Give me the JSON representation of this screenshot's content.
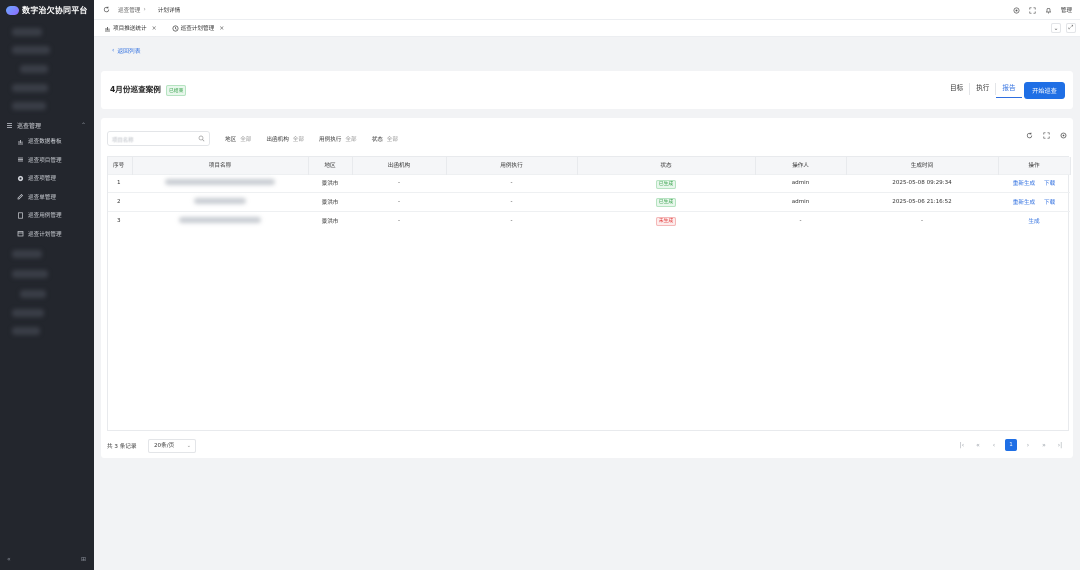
{
  "app": {
    "title": "数字治欠协同平台"
  },
  "sidebar": {
    "group_label": "巡查管理",
    "items": [
      {
        "label": "巡查数据看板",
        "icon": "chart-icon"
      },
      {
        "label": "巡查项目管理",
        "icon": "list-icon"
      },
      {
        "label": "巡查项管理",
        "icon": "gear-icon"
      },
      {
        "label": "巡查单管理",
        "icon": "edit-icon"
      },
      {
        "label": "巡查用例管理",
        "icon": "document-icon"
      },
      {
        "label": "巡查计划管理",
        "icon": "calendar-icon"
      }
    ],
    "collapse_label": "«",
    "settings_label": "⊞"
  },
  "topbar": {
    "breadcrumb_1": "巡查管理",
    "breadcrumb_sep": "›",
    "breadcrumb_2": "计划详情",
    "user": "管理"
  },
  "tabs": [
    {
      "label": "项目推送统计",
      "close": "×"
    },
    {
      "label": "巡查计划管理",
      "close": "×"
    }
  ],
  "back_link": "返回列表",
  "header": {
    "title": "4月份巡查案例",
    "badge": "已结束",
    "tabs": [
      "目标",
      "执行",
      "报告"
    ],
    "active_tab": "报告",
    "start_button": "开始巡查"
  },
  "filters": {
    "search_placeholder": "项目名称",
    "items": [
      {
        "label": "地区",
        "value": "全部"
      },
      {
        "label": "出函机构",
        "value": "全部"
      },
      {
        "label": "用例执行",
        "value": "全部"
      },
      {
        "label": "状态",
        "value": "全部"
      }
    ]
  },
  "table": {
    "headers": [
      "序号",
      "项目名称",
      "地区",
      "出函机构",
      "用例执行",
      "状态",
      "操作人",
      "生成时间",
      "操作"
    ],
    "rows": [
      {
        "no": "1",
        "region": "景洪市",
        "org": "-",
        "exec": "-",
        "status": "已生成",
        "status_type": "ok",
        "operator": "admin",
        "time": "2025-05-08 09:29:34",
        "op1": "重新生成",
        "op2": "下载"
      },
      {
        "no": "2",
        "region": "景洪市",
        "org": "-",
        "exec": "-",
        "status": "已生成",
        "status_type": "ok",
        "operator": "admin",
        "time": "2025-05-06 21:16:52",
        "op1": "重新生成",
        "op2": "下载"
      },
      {
        "no": "3",
        "region": "景洪市",
        "org": "-",
        "exec": "-",
        "status": "未生成",
        "status_type": "no",
        "operator": "-",
        "time": "-",
        "op1": "生成",
        "op2": ""
      }
    ]
  },
  "pager": {
    "total": "共 3 条记录",
    "page_size": "20条/页",
    "current_page": "1"
  },
  "colors": {
    "accent": "#1f6fe5",
    "sidebar_bg": "#23262d",
    "success": "#2f9e44",
    "danger": "#e03131"
  }
}
